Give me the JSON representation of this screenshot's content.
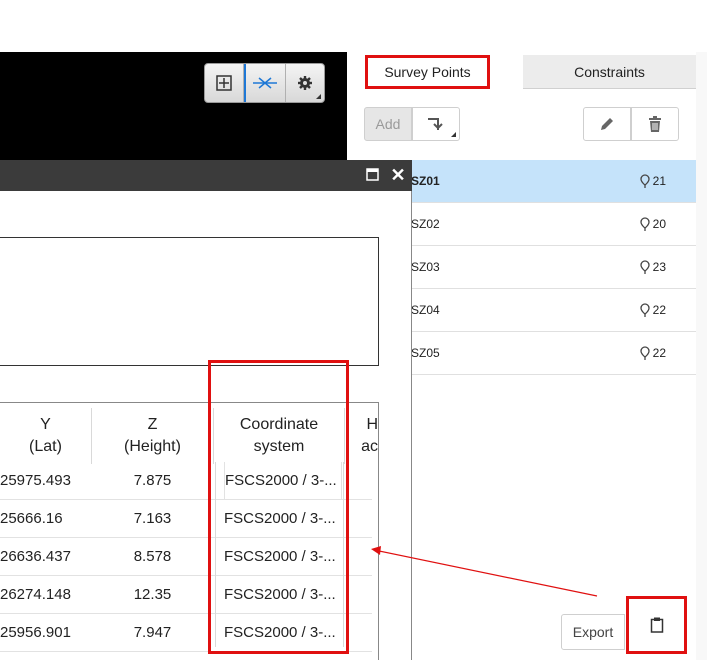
{
  "toolbar": {
    "buttons": [
      {
        "name": "fit-view",
        "icon": "grid-plus-icon"
      },
      {
        "name": "measure",
        "icon": "scissors-line-icon"
      },
      {
        "name": "settings",
        "icon": "gear-icon"
      }
    ]
  },
  "tabs": {
    "survey_points": "Survey Points",
    "constraints": "Constraints"
  },
  "actions": {
    "add_label": "Add",
    "export_label": "Export"
  },
  "points": [
    {
      "name": "SZ01",
      "count": "21",
      "selected": true
    },
    {
      "name": "SZ02",
      "count": "20",
      "selected": false
    },
    {
      "name": "SZ03",
      "count": "23",
      "selected": false
    },
    {
      "name": "SZ04",
      "count": "22",
      "selected": false
    },
    {
      "name": "SZ05",
      "count": "22",
      "selected": false
    }
  ],
  "table": {
    "headers": {
      "y": [
        "Y",
        "(Lat)"
      ],
      "z": [
        "Z",
        "(Height)"
      ],
      "coord": [
        "Coordinate",
        "system"
      ],
      "h": [
        "H",
        "ac"
      ]
    },
    "rows": [
      {
        "y": "25975.493",
        "z": "7.875",
        "coord": "FSCS2000 / 3-..."
      },
      {
        "y": "25666.16",
        "z": "7.163",
        "coord": "FSCS2000 / 3-..."
      },
      {
        "y": "26636.437",
        "z": "8.578",
        "coord": "FSCS2000 / 3-..."
      },
      {
        "y": "26274.148",
        "z": "12.35",
        "coord": "FSCS2000 / 3-..."
      },
      {
        "y": "25956.901",
        "z": "7.947",
        "coord": "FSCS2000 / 3-..."
      }
    ]
  },
  "colors": {
    "annotation": "#e01010",
    "selected_row": "#c5e3fa",
    "accent": "#1e78d6"
  }
}
